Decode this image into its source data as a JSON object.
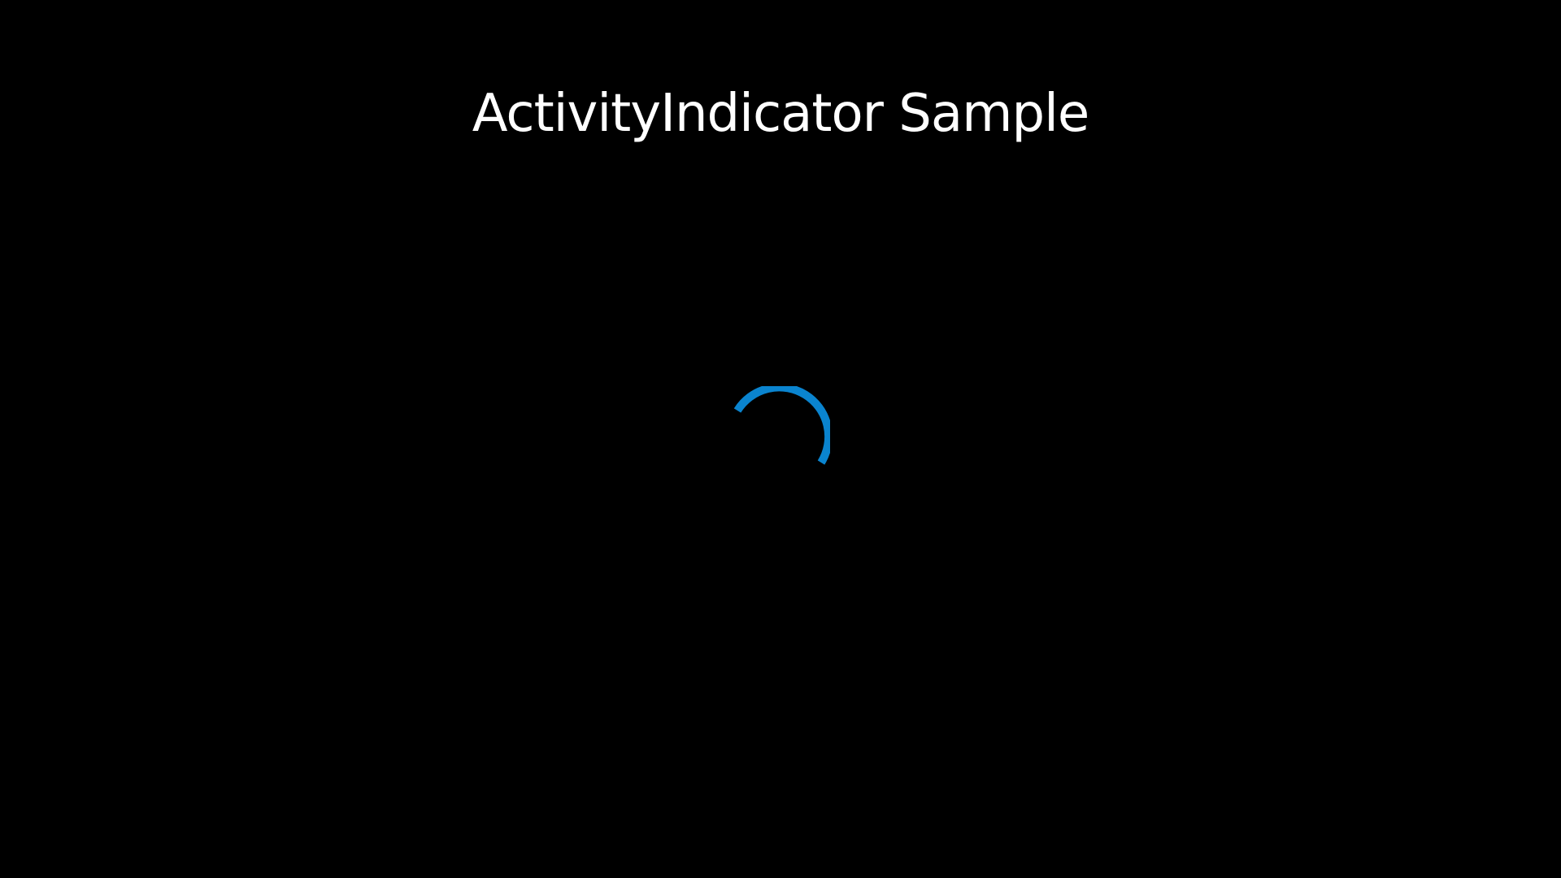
{
  "page": {
    "title": "ActivityIndicator Sample"
  },
  "activity_indicator": {
    "state": "running",
    "accent_color": "#0a84cf"
  },
  "colors": {
    "background": "#000000",
    "text": "#ffffff",
    "accent": "#0a84cf"
  }
}
